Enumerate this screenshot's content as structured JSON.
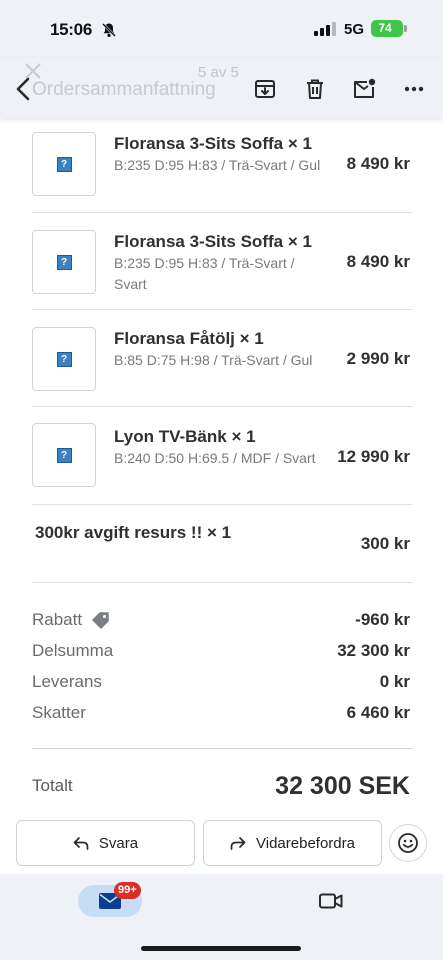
{
  "status_bar": {
    "time": "15:06",
    "network": "5G",
    "battery": "74"
  },
  "toolbar": {
    "ghost_title": "Ordersammanfattning",
    "ghost_count": "5 av 5",
    "icons": [
      "back-icon",
      "archive-icon",
      "delete-icon",
      "mark-unread-icon",
      "more-icon"
    ]
  },
  "items": [
    {
      "name": "Floransa 3-Sits Soffa × 1",
      "variant": "B:235 D:95 H:83 / Trä-Svart / Gul",
      "price": "8 490 kr"
    },
    {
      "name": "Floransa 3-Sits Soffa × 1",
      "variant": "B:235 D:95 H:83 / Trä-Svart / Svart",
      "price": "8 490 kr"
    },
    {
      "name": "Floransa Fåtölj × 1",
      "variant": "B:85 D:75 H:98 / Trä-Svart / Gul",
      "price": "2 990 kr"
    },
    {
      "name": "Lyon TV-Bänk × 1",
      "variant": "B:240 D:50 H:69.5 / MDF / Svart",
      "price": "12 990 kr"
    }
  ],
  "fee": {
    "name": "300kr avgift resurs !! × 1",
    "price": "300 kr"
  },
  "summary": {
    "discount_label": "Rabatt",
    "discount_value": "-960 kr",
    "subtotal_label": "Delsumma",
    "subtotal_value": "32 300 kr",
    "shipping_label": "Leverans",
    "shipping_value": "0 kr",
    "tax_label": "Skatter",
    "tax_value": "6 460 kr",
    "total_label": "Totalt",
    "total_value": "32 300 SEK"
  },
  "actions": {
    "reply_label": "Svara",
    "forward_label": "Vidarebefordra"
  },
  "nav": {
    "badge": "99+"
  },
  "colors": {
    "accent_pill": "#c7dcf7",
    "badge": "#d93025",
    "battery": "#3ec54a",
    "bar_bg": "#eef1f6"
  }
}
